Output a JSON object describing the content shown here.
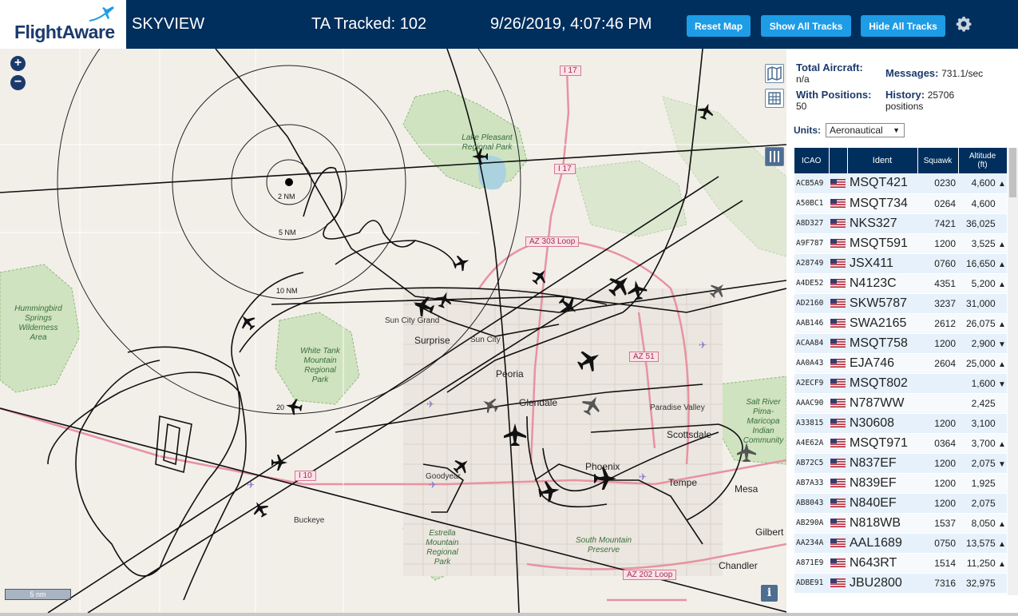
{
  "header": {
    "logo_text": "FlightAware",
    "app_title": "SKYVIEW",
    "tracked_text": "TA Tracked: 102",
    "datetime": "9/26/2019, 4:07:46 PM",
    "buttons": {
      "reset": "Reset Map",
      "show": "Show All Tracks",
      "hide": "Hide All Tracks"
    }
  },
  "colors": {
    "header_bg": "#002f5d",
    "button_bg": "#1e9ce6",
    "accent": "#1b3a6b"
  },
  "stats": {
    "total_aircraft_label": "Total Aircraft:",
    "total_aircraft_value": "n/a",
    "with_positions_label": "With Positions:",
    "with_positions_value": "50",
    "messages_label": "Messages:",
    "messages_value": "731.1/sec",
    "history_label": "History:",
    "history_value": "25706",
    "history_unit": "positions"
  },
  "units": {
    "label": "Units:",
    "selected": "Aeronautical"
  },
  "table": {
    "headers": {
      "icao": "ICAO",
      "flag": "",
      "ident": "Ident",
      "squawk": "Squawk",
      "altitude": "Altitude",
      "altitude_unit": "(ft)"
    },
    "rows": [
      {
        "icao": "ACB5A9",
        "ident": "MSQT421",
        "squawk": "0230",
        "alt": "4,600",
        "trend": "▲"
      },
      {
        "icao": "A50BC1",
        "ident": "MSQT734",
        "squawk": "0264",
        "alt": "4,600",
        "trend": ""
      },
      {
        "icao": "A8D327",
        "ident": "NKS327",
        "squawk": "7421",
        "alt": "36,025",
        "trend": ""
      },
      {
        "icao": "A9F787",
        "ident": "MSQT591",
        "squawk": "1200",
        "alt": "3,525",
        "trend": "▲"
      },
      {
        "icao": "A28749",
        "ident": "JSX411",
        "squawk": "0760",
        "alt": "16,650",
        "trend": "▲"
      },
      {
        "icao": "A4DE52",
        "ident": "N4123C",
        "squawk": "4351",
        "alt": "5,200",
        "trend": "▲"
      },
      {
        "icao": "AD2160",
        "ident": "SKW5787",
        "squawk": "3237",
        "alt": "31,000",
        "trend": ""
      },
      {
        "icao": "AAB146",
        "ident": "SWA2165",
        "squawk": "2612",
        "alt": "26,075",
        "trend": "▲"
      },
      {
        "icao": "ACAA84",
        "ident": "MSQT758",
        "squawk": "1200",
        "alt": "2,900",
        "trend": "▼"
      },
      {
        "icao": "AA0A43",
        "ident": "EJA746",
        "squawk": "2604",
        "alt": "25,000",
        "trend": "▲"
      },
      {
        "icao": "A2ECF9",
        "ident": "MSQT802",
        "squawk": "",
        "alt": "1,600",
        "trend": "▼"
      },
      {
        "icao": "AAAC90",
        "ident": "N787WW",
        "squawk": "",
        "alt": "2,425",
        "trend": ""
      },
      {
        "icao": "A33815",
        "ident": "N30608",
        "squawk": "1200",
        "alt": "3,100",
        "trend": ""
      },
      {
        "icao": "A4E62A",
        "ident": "MSQT971",
        "squawk": "0364",
        "alt": "3,700",
        "trend": "▲"
      },
      {
        "icao": "AB72C5",
        "ident": "N837EF",
        "squawk": "1200",
        "alt": "2,075",
        "trend": "▼"
      },
      {
        "icao": "AB7A33",
        "ident": "N839EF",
        "squawk": "1200",
        "alt": "1,925",
        "trend": ""
      },
      {
        "icao": "AB8043",
        "ident": "N840EF",
        "squawk": "1200",
        "alt": "2,075",
        "trend": ""
      },
      {
        "icao": "AB290A",
        "ident": "N818WB",
        "squawk": "1537",
        "alt": "8,050",
        "trend": "▲"
      },
      {
        "icao": "AA234A",
        "ident": "AAL1689",
        "squawk": "0750",
        "alt": "13,575",
        "trend": "▲"
      },
      {
        "icao": "A871E9",
        "ident": "N643RT",
        "squawk": "1514",
        "alt": "11,250",
        "trend": "▲"
      },
      {
        "icao": "ADBE91",
        "ident": "JBU2800",
        "squawk": "7316",
        "alt": "32,975",
        "trend": ""
      }
    ]
  },
  "map": {
    "zoom_in": "+",
    "zoom_out": "−",
    "scale": "5 nm",
    "info": "i",
    "rings": [
      "2 NM",
      "5 NM",
      "10 NM",
      "20"
    ],
    "cities": [
      "Surprise",
      "Sun City Grand",
      "Sun City",
      "Peoria",
      "Glendale",
      "Paradise Valley",
      "Scottsdale",
      "Phoenix",
      "Tempe",
      "Mesa",
      "Gilbert",
      "Chandler",
      "Goodyear",
      "Buckeye"
    ],
    "parks": [
      "Lake Pleasant Regional Park",
      "Hummingbird Springs Wilderness Area",
      "White Tank Mountain Regional Park",
      "Estrella Mountain Regional Park",
      "South Mountain Preserve",
      "Salt River Pima-Maricopa Indian Community"
    ],
    "roads": [
      "I 17",
      "I 17",
      "AZ 303 Loop",
      "AZ 51",
      "I 10",
      "AZ 202 Loop"
    ],
    "icons": [
      "zoom-in-icon",
      "zoom-out-icon",
      "map-layer-icon",
      "grid-icon",
      "columns-icon",
      "info-icon",
      "gear-icon",
      "airplane-icon"
    ]
  }
}
